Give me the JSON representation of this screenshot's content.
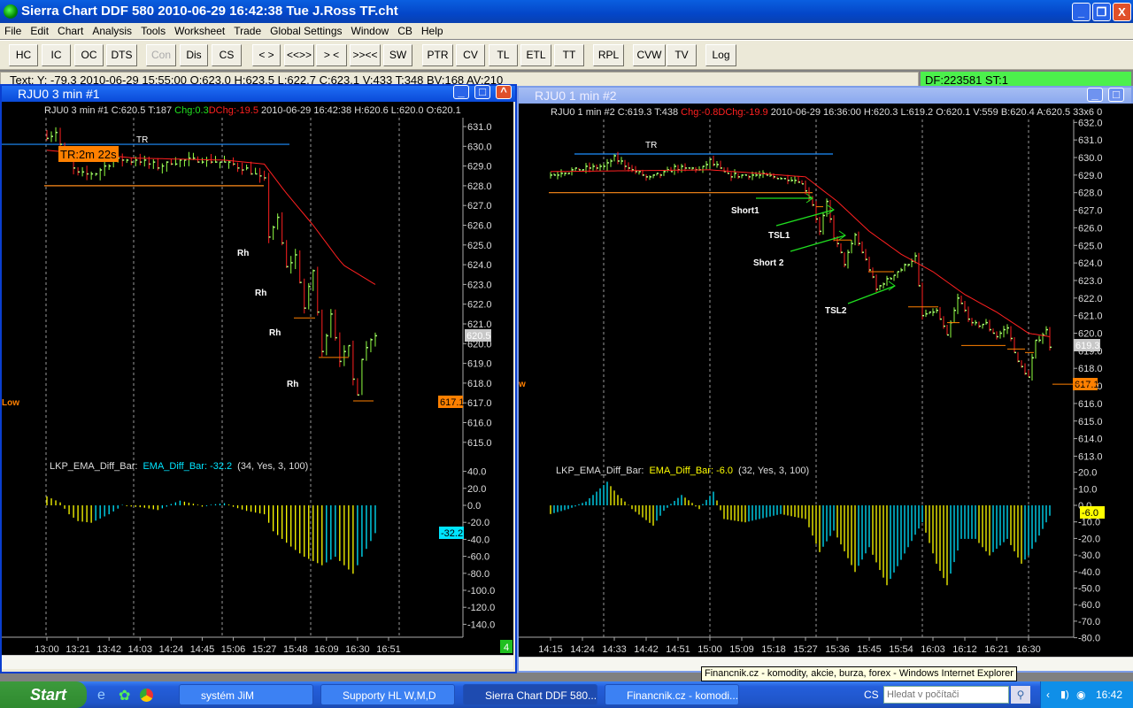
{
  "app": {
    "title": "Sierra Chart DDF 580  2010-06-29  16:42:38  Tue   J.Ross TF.cht",
    "minimize": "_",
    "restore": "❐",
    "close": "X"
  },
  "menu": [
    "File",
    "Edit",
    "Chart",
    "Analysis",
    "Tools",
    "Worksheet",
    "Trade",
    "Global Settings",
    "Window",
    "CB",
    "Help"
  ],
  "toolbar": [
    "HC",
    "IC",
    "OC",
    "DTS",
    "Con",
    "Dis",
    "CS",
    "< >",
    "<<>>",
    "> <",
    ">><<",
    "SW",
    "PTR",
    "CV",
    "TL",
    "ETL",
    "TT",
    "RPL",
    "CVW",
    "TV",
    "Log"
  ],
  "infobar": {
    "text": "Text: Y: -79.3  2010-06-29  15:55:00  O:623.0  H:623.5  L:622.7  C:623.1  V:433  T:348  BV:168  AV:210",
    "df": "DF:223581   ST:1"
  },
  "colors": {
    "up": "#ff2020",
    "down": "#90ff40",
    "ema": "#ff2020",
    "tr_line": "#1e90ff",
    "support": "#ff8c1a",
    "osc_a": "#ffff00",
    "osc_b": "#00e5ff"
  },
  "left_chart": {
    "window_title": "RJU0  3 min   #1",
    "header": {
      "pre": "RJU0  3 min   #1 C:620.5 T:187 ",
      "chg": "Chg:0.3",
      "dchg": "DChg:-19.5",
      "post": " 2010-06-29 16:42:38 H:620.6 L:620.0 O:620.1"
    },
    "price_ticks": [
      "631.0",
      "630.0",
      "629.0",
      "628.0",
      "627.0",
      "626.0",
      "625.0",
      "624.0",
      "623.0",
      "622.0",
      "621.0",
      "620.0",
      "619.0",
      "618.0",
      "617.0",
      "616.0",
      "615.0"
    ],
    "osc_ticks": [
      "40.0",
      "20.0",
      "0.0",
      "-20.0",
      "-40.0",
      "-60.0",
      "-80.0",
      "-100.0",
      "-120.0",
      "-140.0"
    ],
    "time_ticks": [
      "13:00",
      "13:21",
      "13:42",
      "14:03",
      "14:24",
      "14:45",
      "15:06",
      "15:27",
      "15:48",
      "16:09",
      "16:30",
      "16:51"
    ],
    "closes": [
      [
        "13:00",
        630.5
      ],
      [
        "13:06",
        630.7
      ],
      [
        "13:12",
        629.5
      ],
      [
        "13:21",
        628.6
      ],
      [
        "13:33",
        628.6
      ],
      [
        "13:45",
        629.3
      ],
      [
        "14:00",
        629.3
      ],
      [
        "14:15",
        629.0
      ],
      [
        "14:30",
        629.3
      ],
      [
        "14:45",
        629.3
      ],
      [
        "15:00",
        629.2
      ],
      [
        "15:15",
        628.8
      ],
      [
        "15:27",
        628.3
      ],
      [
        "15:30",
        625.5
      ],
      [
        "15:36",
        626.3
      ],
      [
        "15:42",
        623.8
      ],
      [
        "15:48",
        624.5
      ],
      [
        "15:54",
        621.8
      ],
      [
        "16:00",
        623.7
      ],
      [
        "16:06",
        619.5
      ],
      [
        "16:12",
        621.6
      ],
      [
        "16:18",
        619.2
      ],
      [
        "16:24",
        619.8
      ],
      [
        "16:27",
        618.2
      ],
      [
        "16:30",
        617.5
      ],
      [
        "16:33",
        619.3
      ],
      [
        "16:39",
        620.3
      ],
      [
        "16:42",
        620.5
      ]
    ],
    "ema": [
      [
        "13:00",
        629.8
      ],
      [
        "14:00",
        629.4
      ],
      [
        "15:00",
        629.3
      ],
      [
        "15:27",
        629.1
      ],
      [
        "15:40",
        627.8
      ],
      [
        "16:00",
        626.0
      ],
      [
        "16:20",
        624.0
      ],
      [
        "16:42",
        623.0
      ]
    ],
    "osc": [
      [
        "13:00",
        10
      ],
      [
        "13:09",
        3
      ],
      [
        "13:15",
        -10
      ],
      [
        "13:21",
        -18
      ],
      [
        "13:30",
        -20
      ],
      [
        "13:42",
        -10
      ],
      [
        "13:51",
        0
      ],
      [
        "14:05",
        -2
      ],
      [
        "14:15",
        -5
      ],
      [
        "14:30",
        5
      ],
      [
        "14:45",
        -1
      ],
      [
        "15:00",
        2
      ],
      [
        "15:15",
        -6
      ],
      [
        "15:27",
        -10
      ],
      [
        "15:33",
        -30
      ],
      [
        "15:45",
        -48
      ],
      [
        "15:54",
        -60
      ],
      [
        "16:06",
        -70
      ],
      [
        "16:15",
        -60
      ],
      [
        "16:27",
        -80
      ],
      [
        "16:33",
        -60
      ],
      [
        "16:42",
        -32.2
      ]
    ],
    "annotations": {
      "tr": "TR",
      "tr_timer": "TR:2m 22s",
      "rh": [
        "Rh",
        "Rh",
        "Rh",
        "Rh"
      ],
      "low": "Low"
    },
    "tr_level": 630.1,
    "support_level": 628.0,
    "last_price": "620.5",
    "low_price": "617.1",
    "osc_label": {
      "name": "LKP_EMA_Diff_Bar:",
      "value": "EMA_Diff_Bar: -32.2",
      "params": "(34, Yes, 3, 100)",
      "marker": "-32.2"
    },
    "page_badge": "4"
  },
  "right_chart": {
    "window_title": "RJU0  1 min   #2",
    "header": {
      "pre": "RJU0  1 min   #2 C:619.3 T:438 ",
      "chg": "Chg:-0.8",
      "dchg": "DChg:-19.9",
      "post": " 2010-06-29 16:36:00 H:620.3 L:619.2 O:620.1 V:559 B:620.4 A:620.5 33x6 0"
    },
    "price_ticks": [
      "632.0",
      "631.0",
      "630.0",
      "629.0",
      "628.0",
      "627.0",
      "626.0",
      "625.0",
      "624.0",
      "623.0",
      "622.0",
      "621.0",
      "620.0",
      "619.0",
      "618.0",
      "617.0",
      "616.0",
      "615.0",
      "614.0",
      "613.0"
    ],
    "osc_ticks": [
      "20.0",
      "10.0",
      "0.0",
      "-10.0",
      "-20.0",
      "-30.0",
      "-40.0",
      "-50.0",
      "-60.0",
      "-70.0",
      "-80.0"
    ],
    "time_ticks": [
      "14:15",
      "14:24",
      "14:33",
      "14:42",
      "14:51",
      "15:00",
      "15:09",
      "15:18",
      "15:27",
      "15:36",
      "15:45",
      "15:54",
      "16:03",
      "16:12",
      "16:21",
      "16:30"
    ],
    "closes": [
      [
        "14:15",
        629.0
      ],
      [
        "14:22",
        629.3
      ],
      [
        "14:30",
        629.5
      ],
      [
        "14:33",
        630.0
      ],
      [
        "14:38",
        629.3
      ],
      [
        "14:43",
        628.8
      ],
      [
        "14:50",
        629.4
      ],
      [
        "14:57",
        629.3
      ],
      [
        "15:00",
        629.8
      ],
      [
        "15:05",
        629.0
      ],
      [
        "15:15",
        629.0
      ],
      [
        "15:25",
        628.7
      ],
      [
        "15:27",
        628.2
      ],
      [
        "15:29",
        627.3
      ],
      [
        "15:31",
        625.8
      ],
      [
        "15:33",
        627.4
      ],
      [
        "15:35",
        625.5
      ],
      [
        "15:38",
        624.0
      ],
      [
        "15:41",
        625.6
      ],
      [
        "15:44",
        624.2
      ],
      [
        "15:47",
        622.5
      ],
      [
        "15:50",
        623.0
      ],
      [
        "15:56",
        624.0
      ],
      [
        "15:58",
        624.3
      ],
      [
        "16:00",
        621.0
      ],
      [
        "16:04",
        621.3
      ],
      [
        "16:07",
        619.8
      ],
      [
        "16:10",
        622.0
      ],
      [
        "16:14",
        620.5
      ],
      [
        "16:18",
        620.5
      ],
      [
        "16:21",
        619.8
      ],
      [
        "16:24",
        620.3
      ],
      [
        "16:27",
        618.3
      ],
      [
        "16:30",
        617.5
      ],
      [
        "16:32",
        619.5
      ],
      [
        "16:35",
        620.2
      ],
      [
        "16:36",
        619.3
      ]
    ],
    "ema": [
      [
        "14:15",
        629.2
      ],
      [
        "15:00",
        629.3
      ],
      [
        "15:27",
        628.9
      ],
      [
        "15:36",
        627.5
      ],
      [
        "15:45",
        625.8
      ],
      [
        "15:54",
        624.5
      ],
      [
        "16:03",
        623.5
      ],
      [
        "16:12",
        622.2
      ],
      [
        "16:21",
        621.2
      ],
      [
        "16:30",
        620.0
      ],
      [
        "16:36",
        619.8
      ]
    ],
    "osc": [
      [
        "14:15",
        -5
      ],
      [
        "14:20",
        -2
      ],
      [
        "14:25",
        2
      ],
      [
        "14:31",
        14
      ],
      [
        "14:34",
        6
      ],
      [
        "14:38",
        -2
      ],
      [
        "14:44",
        -12
      ],
      [
        "14:47",
        -3
      ],
      [
        "14:52",
        6
      ],
      [
        "14:57",
        -2
      ],
      [
        "15:01",
        8
      ],
      [
        "15:04",
        -8
      ],
      [
        "15:10",
        -10
      ],
      [
        "15:20",
        -5
      ],
      [
        "15:27",
        -8
      ],
      [
        "15:31",
        -28
      ],
      [
        "15:35",
        -15
      ],
      [
        "15:41",
        -40
      ],
      [
        "15:45",
        -25
      ],
      [
        "15:50",
        -48
      ],
      [
        "15:56",
        -25
      ],
      [
        "16:00",
        -10
      ],
      [
        "16:04",
        -35
      ],
      [
        "16:07",
        -48
      ],
      [
        "16:11",
        -20
      ],
      [
        "16:15",
        -20
      ],
      [
        "16:19",
        -30
      ],
      [
        "16:24",
        -20
      ],
      [
        "16:28",
        -35
      ],
      [
        "16:30",
        -30
      ],
      [
        "16:36",
        -6
      ]
    ],
    "annotations": {
      "tr": "TR",
      "short1": "Short1",
      "tsl1": "TSL1",
      "short2": "Short 2",
      "tsl2": "TSL2",
      "low": "w"
    },
    "tr_level": 630.2,
    "support_level": 628.0,
    "last_price": "619.3",
    "low_price": "617.1",
    "osc_label": {
      "name": "LKP_EMA_Diff_Bar:",
      "value": "EMA_Diff_Bar: -6.0",
      "params": "(32, Yes, 3, 100)",
      "marker": "-6.0"
    }
  },
  "tooltip": "Financnik.cz - komodity, akcie, burza, forex - Windows Internet Explorer",
  "taskbar": {
    "start": "Start",
    "tasks": [
      "systém JiM",
      "Supporty HL W,M,D",
      "Sierra Chart DDF 580...",
      "Financnik.cz - komodi..."
    ],
    "lang": "CS",
    "search_placeholder": "Hledat v počítači",
    "clock": "16:42"
  }
}
